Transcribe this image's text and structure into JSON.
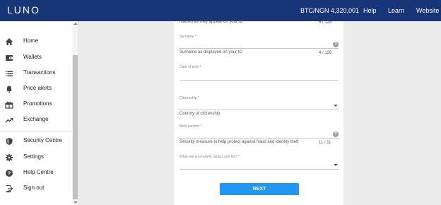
{
  "header": {
    "logo": "LUNO",
    "price": "BTC/NGN 4,320,001",
    "help": "Help",
    "learn": "Learn",
    "website": "Website"
  },
  "sidebar": {
    "items": [
      {
        "label": "Home",
        "icon": "home-icon"
      },
      {
        "label": "Wallets",
        "icon": "wallet-icon"
      },
      {
        "label": "Transactions",
        "icon": "list-icon"
      },
      {
        "label": "Price alerts",
        "icon": "bell-icon"
      },
      {
        "label": "Promotions",
        "icon": "gift-icon"
      },
      {
        "label": "Exchange",
        "icon": "trending-icon"
      },
      {
        "label": "Security Centre",
        "icon": "shield-icon"
      },
      {
        "label": "Settings",
        "icon": "gear-icon"
      },
      {
        "label": "Help Centre",
        "icon": "help-icon"
      },
      {
        "label": "Sign out",
        "icon": "sign-out-icon"
      }
    ]
  },
  "form": {
    "names_helper": "Names as they appear on your ID",
    "names_counter": "6 / 128",
    "surname_label": "Surname *",
    "surname_helper": "Surname as displayed on your ID",
    "surname_counter": "4 / 128",
    "dob_label": "Date of birth *",
    "citizenship_label": "Citizenship *",
    "citizenship_helper": "Country of citizenship",
    "birth_number_label": "Birth number *",
    "birth_number_helper": "Security measure to help protect against fraud and identity theft",
    "birth_number_counter": "11 / 11",
    "usage_label": "What are you mainly using Luno for? *",
    "help_glyph": "?",
    "next_label": "NEXT"
  },
  "colors": {
    "header_bg": "#183677",
    "accent": "#2196f3"
  }
}
